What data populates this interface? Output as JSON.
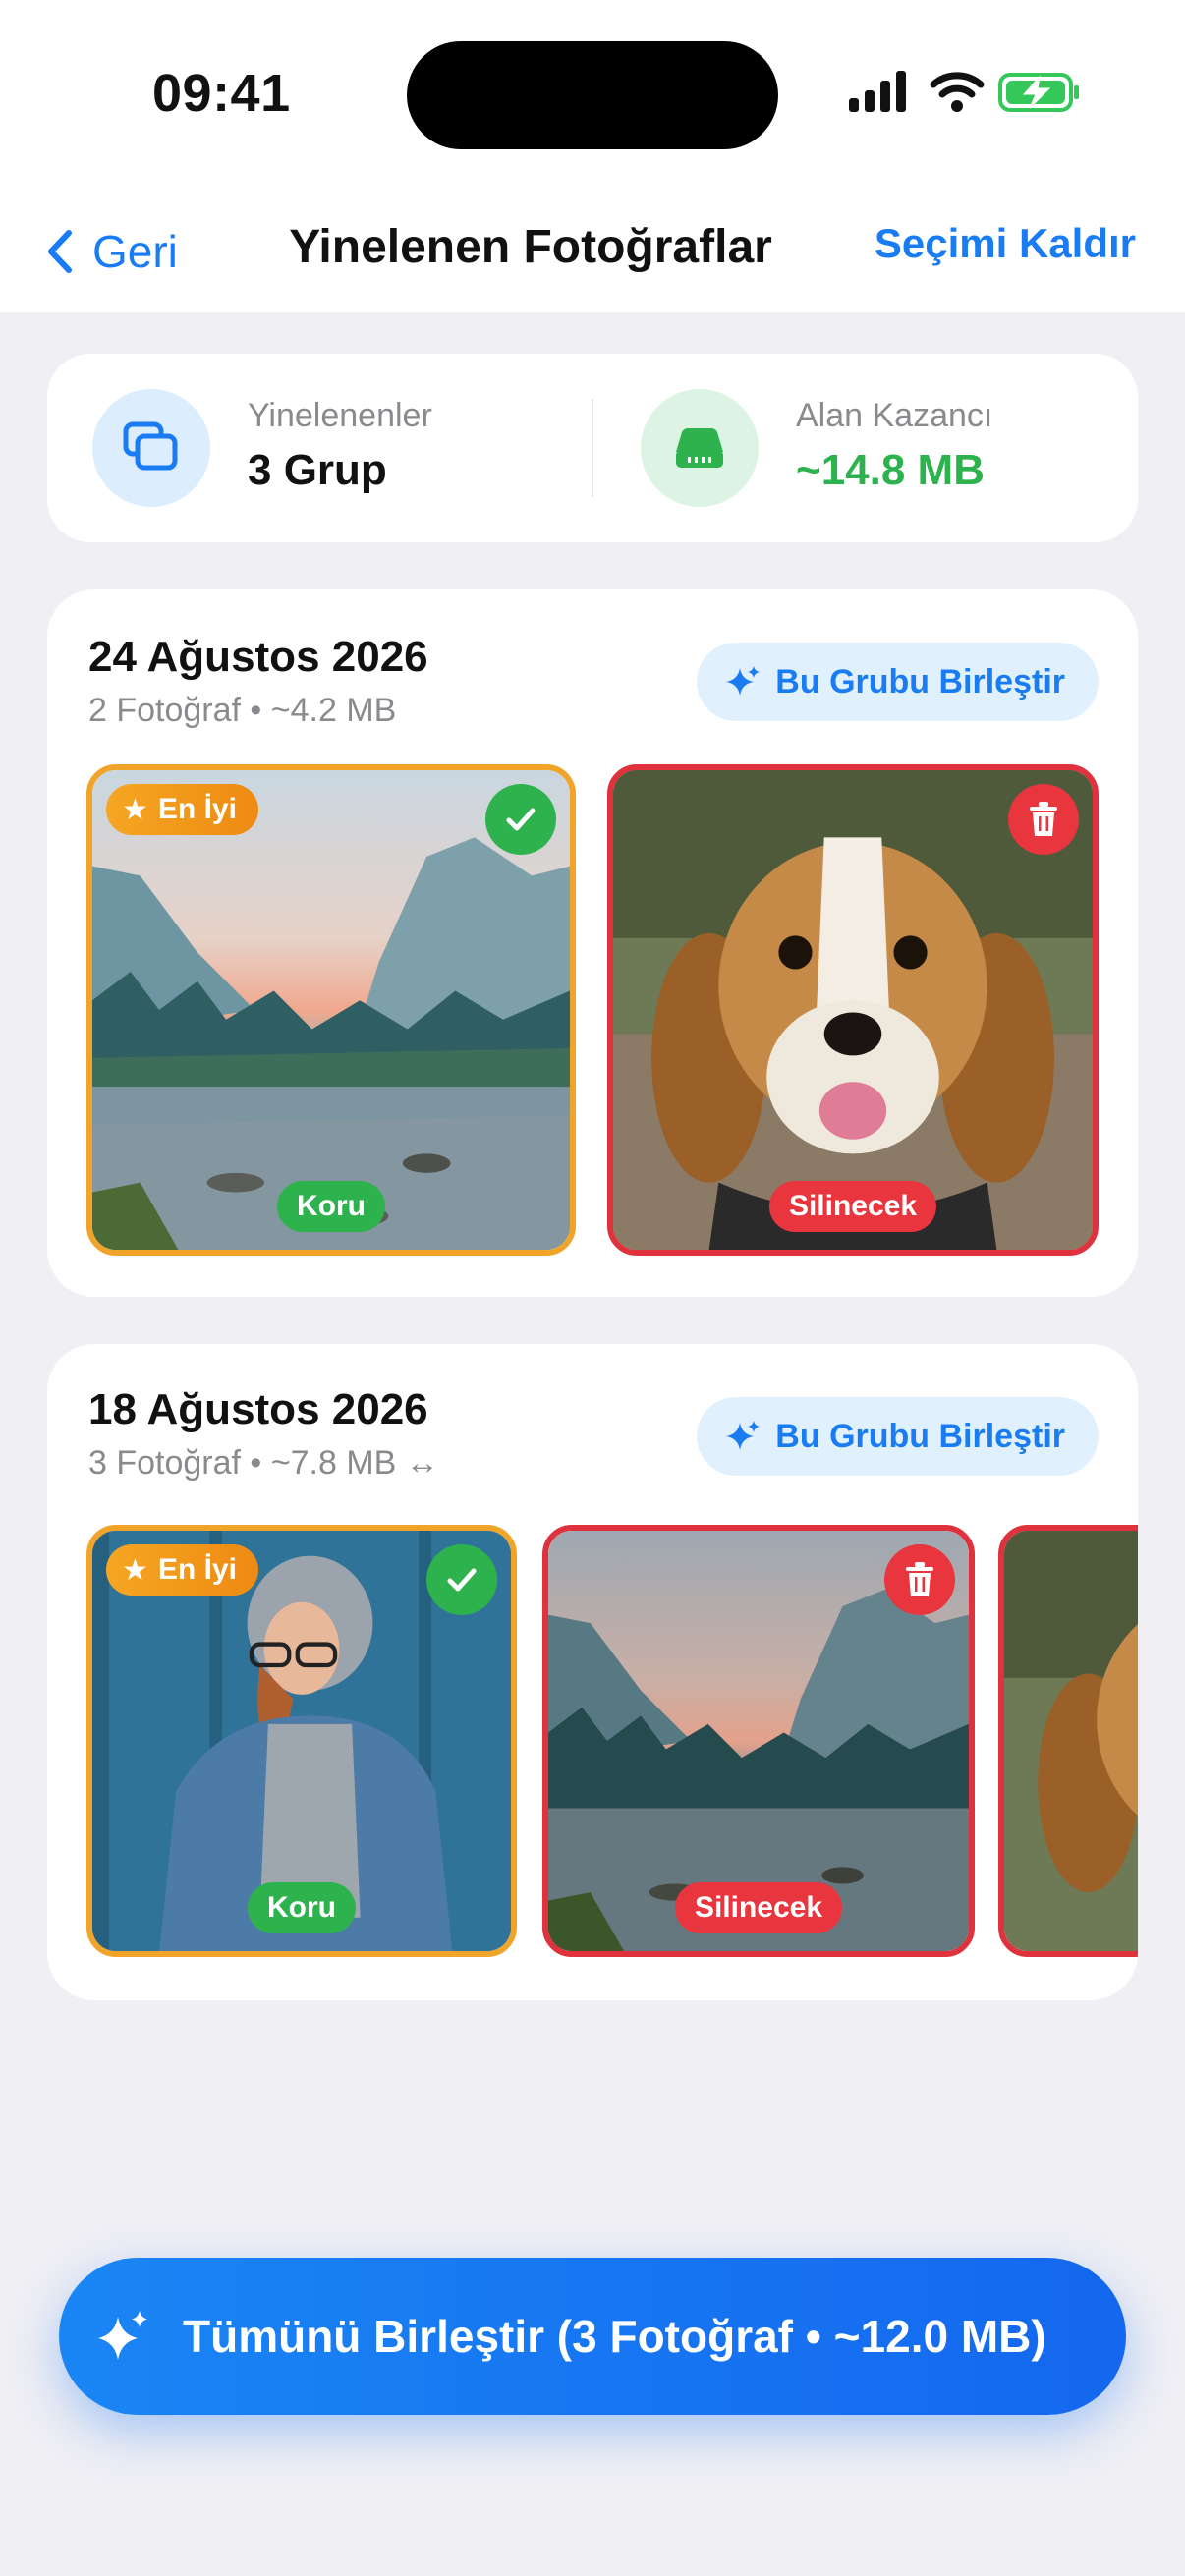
{
  "status": {
    "time": "09:41"
  },
  "nav": {
    "back_label": "Geri",
    "title": "Yinelenen Fotoğraflar",
    "right_action": "Seçimi Kaldır"
  },
  "summary": {
    "duplicates_label": "Yinelenenler",
    "duplicates_value": "3 Grup",
    "space_label": "Alan Kazancı",
    "space_value": "~14.8 MB",
    "space_color": "#2EB24E"
  },
  "groups": [
    {
      "date": "24 Ağustos 2026",
      "meta": "2 Fotoğraf • ~4.2 MB",
      "merge_label": "Bu Grubu Birleştir",
      "photos": [
        {
          "subject": "mountain-lake",
          "best_label": "En İyi",
          "status": "Koru"
        },
        {
          "subject": "beagle-dog",
          "status": "Silinecek"
        }
      ]
    },
    {
      "date": "18 Ağustos 2026",
      "meta": "3 Fotoğraf • ~7.8 MB ↔",
      "merge_label": "Bu Grubu Birleştir",
      "photos": [
        {
          "subject": "woman-hoodie",
          "best_label": "En İyi",
          "status": "Koru"
        },
        {
          "subject": "mountain-lake",
          "status": "Silinecek"
        },
        {
          "subject": "beagle-dog",
          "status": ""
        }
      ]
    }
  ],
  "cta": {
    "label": "Tümünü Birleştir (3 Fotoğraf • ~12.0 MB)"
  },
  "colors": {
    "accent": "#1A7CF2",
    "keep": "#2EB24E",
    "delete": "#E8353E",
    "best": "#F5A623"
  }
}
